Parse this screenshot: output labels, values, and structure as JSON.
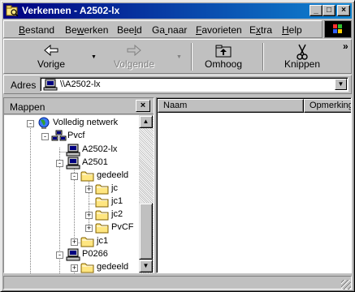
{
  "window": {
    "title": "Verkennen - A2502-lx",
    "min_label": "_",
    "max_label": "□",
    "close_label": "×"
  },
  "menu": [
    {
      "label": "Bestand"
    },
    {
      "label": "Bewerken"
    },
    {
      "label": "Beeld"
    },
    {
      "label": "Ga naar"
    },
    {
      "label": "Favorieten"
    },
    {
      "label": "Extra"
    },
    {
      "label": "Help"
    }
  ],
  "toolbar": {
    "back_label": "Vorige",
    "forward_label": "Volgende",
    "up_label": "Omhoog",
    "cut_label": "Knippen",
    "more_label": "»",
    "dropdown_glyph": "▼"
  },
  "address": {
    "label": "Adres",
    "value": "\\\\A2502-lx",
    "dropdown_glyph": "▼"
  },
  "folders_pane": {
    "title": "Mappen",
    "close_label": "×"
  },
  "tree": [
    {
      "label": "Volledig netwerk",
      "icon": "network-globe-icon",
      "toggle": "-"
    },
    {
      "label": "Pvcf",
      "icon": "workgroup-icon",
      "toggle": "-"
    },
    {
      "label": "A2502-lx",
      "icon": "computer-icon",
      "toggle": ""
    },
    {
      "label": "A2501",
      "icon": "computer-icon",
      "toggle": "-"
    },
    {
      "label": "gedeeld",
      "icon": "folder-icon",
      "toggle": "-"
    },
    {
      "label": "jc",
      "icon": "folder-icon",
      "toggle": "+"
    },
    {
      "label": "jc1",
      "icon": "folder-icon",
      "toggle": ""
    },
    {
      "label": "jc2",
      "icon": "folder-icon",
      "toggle": "+"
    },
    {
      "label": "PvCF",
      "icon": "folder-icon",
      "toggle": "+"
    },
    {
      "label": "jc1",
      "icon": "folder-icon",
      "toggle": "+"
    },
    {
      "label": "P0266",
      "icon": "computer-icon",
      "toggle": "-"
    },
    {
      "label": "gedeeld",
      "icon": "folder-icon",
      "toggle": "+"
    }
  ],
  "list": {
    "columns": [
      {
        "label": "Naam"
      },
      {
        "label": "Opmerking"
      }
    ]
  },
  "scrollbar": {
    "up_glyph": "▲",
    "down_glyph": "▼"
  },
  "colors": {
    "title_start": "#000080",
    "title_end": "#1084d0",
    "face": "#c0c0c0",
    "folder": "#ffe680"
  }
}
